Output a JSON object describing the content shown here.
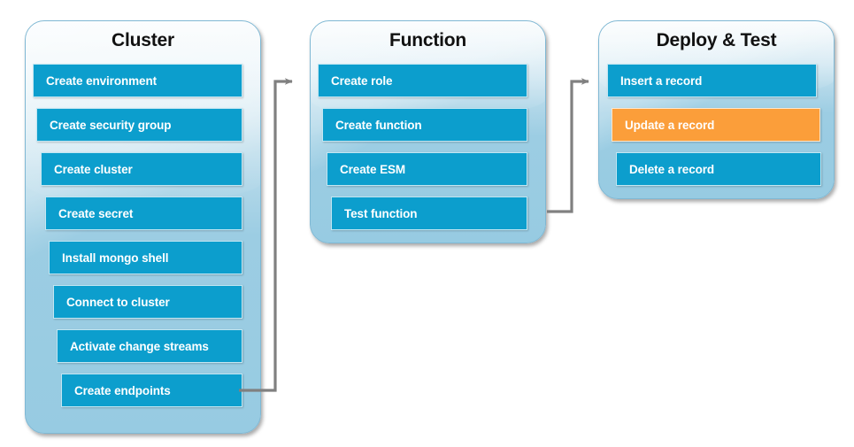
{
  "diagram": {
    "title": "Cluster / Function / Deploy & Test workflow",
    "colors": {
      "step_blue": "#0C9ECD",
      "step_highlight_orange": "#FB9E3A",
      "group_fill_bottom": "#9CCDE3",
      "group_fill_top": "#F2F8FB",
      "group_border": "#7FB8D4",
      "connector_gray": "#808080",
      "title_text": "#111111",
      "step_text": "#FFFFFF"
    }
  },
  "groups": [
    {
      "id": "cluster",
      "title": "Cluster",
      "steps": [
        {
          "label": "Create environment",
          "state": "normal"
        },
        {
          "label": "Create security group",
          "state": "normal"
        },
        {
          "label": "Create cluster",
          "state": "normal"
        },
        {
          "label": "Create secret",
          "state": "normal"
        },
        {
          "label": "Install mongo shell",
          "state": "normal"
        },
        {
          "label": "Connect to cluster",
          "state": "normal"
        },
        {
          "label": "Activate change streams",
          "state": "normal"
        },
        {
          "label": "Create endpoints",
          "state": "normal"
        }
      ]
    },
    {
      "id": "function",
      "title": "Function",
      "steps": [
        {
          "label": "Create role",
          "state": "normal"
        },
        {
          "label": "Create function",
          "state": "normal"
        },
        {
          "label": "Create ESM",
          "state": "normal"
        },
        {
          "label": "Test function",
          "state": "normal"
        }
      ]
    },
    {
      "id": "deploy-test",
      "title": "Deploy & Test",
      "steps": [
        {
          "label": "Insert a record",
          "state": "normal"
        },
        {
          "label": "Update a record",
          "state": "highlight"
        },
        {
          "label": "Delete a record",
          "state": "normal"
        }
      ]
    }
  ],
  "connectors": [
    {
      "id": "cluster-to-function",
      "from": "cluster",
      "to": "function",
      "label": ""
    },
    {
      "id": "function-to-deploy-test",
      "from": "function",
      "to": "deploy-test",
      "label": ""
    }
  ]
}
